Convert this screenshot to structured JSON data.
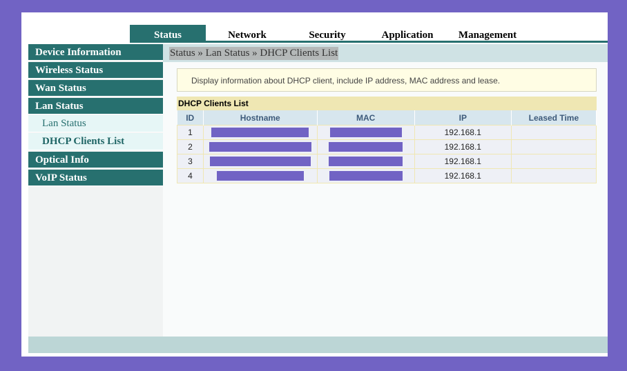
{
  "colors": {
    "frame_bg": "#7163c4",
    "teal": "#27706f",
    "redaction": "#7163c4"
  },
  "topnav": {
    "tabs": [
      {
        "label": "Status",
        "active": true
      },
      {
        "label": "Network",
        "active": false
      },
      {
        "label": "Security",
        "active": false
      },
      {
        "label": "Application",
        "active": false
      },
      {
        "label": "Management",
        "active": false
      }
    ]
  },
  "sidebar": {
    "items": [
      {
        "label": "Device Information"
      },
      {
        "label": "Wireless Status"
      },
      {
        "label": "Wan Status"
      },
      {
        "label": "Lan Status"
      },
      {
        "label": "Lan Status"
      },
      {
        "label": "DHCP Clients List"
      },
      {
        "label": "Optical Info"
      },
      {
        "label": "VoIP Status"
      }
    ]
  },
  "content": {
    "breadcrumb": "Status » Lan Status » DHCP Clients List",
    "info_text": "Display information about DHCP client, include IP address, MAC address and lease.",
    "list_title": "DHCP Clients List",
    "table": {
      "headers": [
        "ID",
        "Hostname",
        "MAC",
        "IP",
        "Leased Time"
      ],
      "rows": [
        {
          "id": "1",
          "hostname": "[redacted]",
          "mac": "[redacted]",
          "ip": "192.168.1",
          "leased": ""
        },
        {
          "id": "2",
          "hostname": "[redacted]",
          "mac": "[redacted]",
          "ip": "192.168.1",
          "leased": ""
        },
        {
          "id": "3",
          "hostname": "[redacted]",
          "mac": "[redacted]",
          "ip": "192.168.1",
          "leased": ""
        },
        {
          "id": "4",
          "hostname": "[redacted]",
          "mac": "[redacted]",
          "ip": "192.168.1",
          "leased": ""
        }
      ]
    }
  }
}
